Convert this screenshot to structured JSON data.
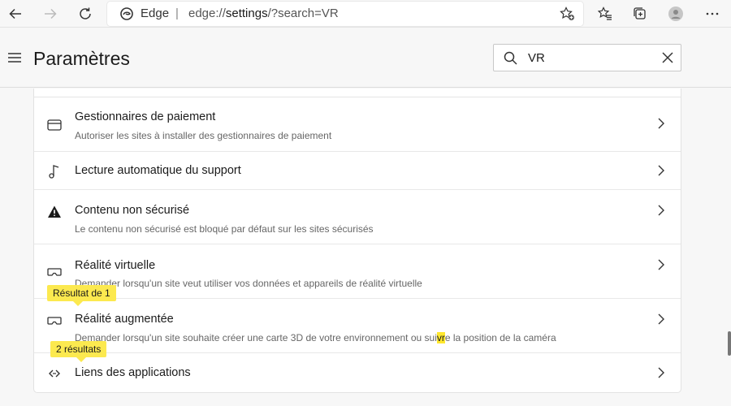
{
  "browser": {
    "brand": "Edge",
    "separator": "|",
    "url_prefix": "edge://",
    "url_host": "settings",
    "url_rest": "/?search=VR"
  },
  "header": {
    "title": "Paramètres",
    "search_value": "VR"
  },
  "rows": [
    {
      "icon": "credit-card-icon",
      "title": "Gestionnaires de paiement",
      "desc": "Autoriser les sites à installer des gestionnaires de paiement"
    },
    {
      "icon": "music-note-icon",
      "title": "Lecture automatique du support",
      "desc": ""
    },
    {
      "icon": "warning-icon",
      "title": "Contenu non sécurisé",
      "desc": "Le contenu non sécurisé est bloqué par défaut sur les sites sécurisés"
    },
    {
      "icon": "vr-headset-icon",
      "title": "Réalité virtuelle",
      "desc": "Demander lorsqu'un site veut utiliser vos données et appareils de réalité virtuelle"
    },
    {
      "icon": "vr-headset-icon",
      "title": "Réalité augmentée",
      "desc_before": "Demander lorsqu'un site souhaite créer une carte 3D de votre environnement ou sui",
      "desc_hl": "vr",
      "desc_after": "e la position de la caméra"
    },
    {
      "icon": "link-icon",
      "title": "Liens des applications",
      "desc": ""
    }
  ],
  "bubbles": {
    "result_of": "Résultat de 1",
    "results_count": "2 résultats"
  },
  "colors": {
    "highlight": "#ffe72e",
    "bubble": "#fce94f"
  }
}
